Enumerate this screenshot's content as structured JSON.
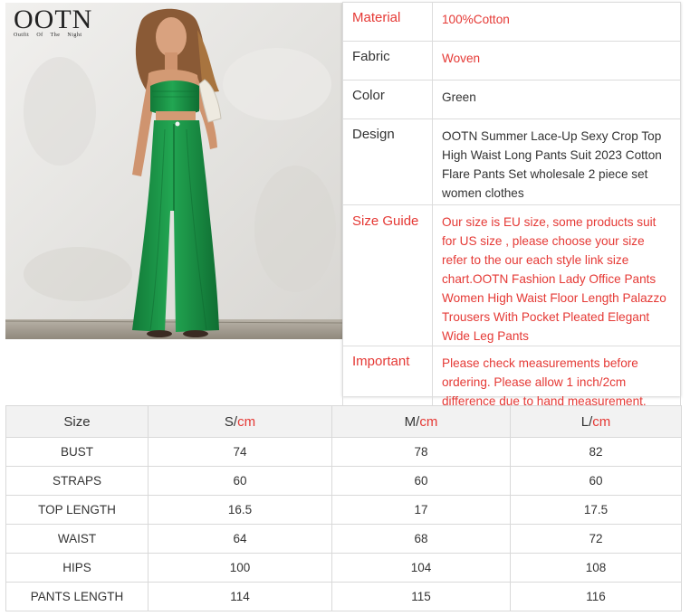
{
  "logo": {
    "mark": "OOTN",
    "tagline": "Outfit Of The Night"
  },
  "attributes": [
    {
      "key": "Material",
      "value": "100%Cotton",
      "key_red": true,
      "value_red": true
    },
    {
      "key": "Fabric",
      "value": "Woven",
      "key_red": false,
      "value_red": true
    },
    {
      "key": "Color",
      "value": "Green",
      "key_red": false,
      "value_red": false
    },
    {
      "key": "Design",
      "value": "OOTN Summer Lace-Up Sexy Crop Top High Waist Long Pants Suit 2023 Cotton Flare Pants Set wholesale 2 piece set women clothes",
      "key_red": false,
      "value_red": false
    },
    {
      "key": "Size Guide",
      "value": "Our size is EU size, some products suit for US size , please choose your size refer to the our each style link size chart.OOTN Fashion Lady Office Pants Women High Waist Floor Length Palazzo Trousers With Pocket Pleated Elegant Wide Leg Pants",
      "key_red": true,
      "value_red": true
    },
    {
      "key": "Important",
      "value": "Please check measurements before ordering. Please allow 1 inch/2cm difference due to hand measurement.",
      "key_red": true,
      "value_red": true
    }
  ],
  "size_table": {
    "header": {
      "label": "Size",
      "columns": [
        {
          "size": "S/",
          "unit": "cm"
        },
        {
          "size": "M/",
          "unit": "cm"
        },
        {
          "size": "L/",
          "unit": "cm"
        }
      ]
    },
    "rows": [
      {
        "name": "BUST",
        "values": [
          "74",
          "78",
          "82"
        ]
      },
      {
        "name": "STRAPS",
        "values": [
          "60",
          "60",
          "60"
        ]
      },
      {
        "name": "TOP LENGTH",
        "values": [
          "16.5",
          "17",
          "17.5"
        ]
      },
      {
        "name": "WAIST",
        "values": [
          "64",
          "68",
          "72"
        ]
      },
      {
        "name": "HIPS",
        "values": [
          "100",
          "104",
          "108"
        ]
      },
      {
        "name": "PANTS LENGTH",
        "values": [
          "114",
          "115",
          "116"
        ]
      }
    ]
  },
  "colors": {
    "accent_red": "#e53935",
    "garment_green": "#1f9a4a"
  }
}
